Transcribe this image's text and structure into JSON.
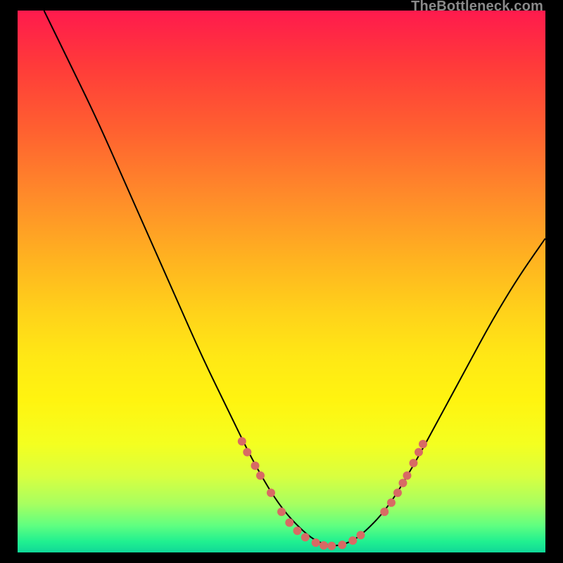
{
  "watermark": "TheBottleneck.com",
  "chart_data": {
    "type": "line",
    "title": "",
    "xlabel": "",
    "ylabel": "",
    "xlim": [
      0,
      100
    ],
    "ylim": [
      0,
      100
    ],
    "grid": false,
    "legend": false,
    "series": [
      {
        "name": "curve",
        "x": [
          5,
          10,
          15,
          20,
          25,
          30,
          35,
          40,
          45,
          50,
          55,
          58,
          60,
          62,
          65,
          70,
          75,
          80,
          85,
          90,
          95,
          100
        ],
        "y": [
          100,
          90,
          80,
          69,
          58,
          47,
          36,
          26,
          16,
          8,
          3,
          1.5,
          1.2,
          1.5,
          3,
          8,
          16,
          25,
          34,
          43,
          51,
          58
        ],
        "stroke": "#000000",
        "stroke_width": 2
      },
      {
        "name": "highlights",
        "type": "scatter",
        "points": [
          [
            42.5,
            20.5
          ],
          [
            43.5,
            18.5
          ],
          [
            45.0,
            16.0
          ],
          [
            46.0,
            14.2
          ],
          [
            48.0,
            11.0
          ],
          [
            50.0,
            7.5
          ],
          [
            51.5,
            5.5
          ],
          [
            53.0,
            4.0
          ],
          [
            54.5,
            2.8
          ],
          [
            56.5,
            1.8
          ],
          [
            58.0,
            1.3
          ],
          [
            59.5,
            1.2
          ],
          [
            61.5,
            1.4
          ],
          [
            63.5,
            2.2
          ],
          [
            65.0,
            3.2
          ],
          [
            69.5,
            7.5
          ],
          [
            70.8,
            9.2
          ],
          [
            72.0,
            11.0
          ],
          [
            73.0,
            12.8
          ],
          [
            73.8,
            14.2
          ],
          [
            75.0,
            16.5
          ],
          [
            76.0,
            18.5
          ],
          [
            76.8,
            20.0
          ]
        ],
        "fill": "#d86a64",
        "radius_px": 6
      }
    ]
  }
}
